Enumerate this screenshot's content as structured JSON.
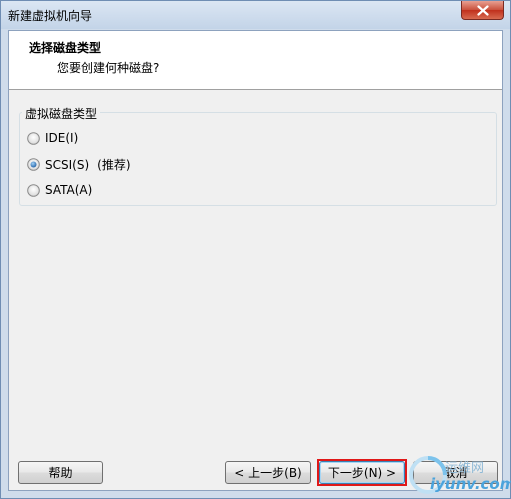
{
  "window": {
    "title": "新建虚拟机向导",
    "close_icon": "close-icon"
  },
  "header": {
    "title": "选择磁盘类型",
    "subtitle": "您要创建何种磁盘?"
  },
  "disk_type_group": {
    "label": "虚拟磁盘类型",
    "options": [
      {
        "label": "IDE(I)",
        "selected": false
      },
      {
        "label": "SCSI(S)",
        "selected": true,
        "note": "(推荐)"
      },
      {
        "label": "SATA(A)",
        "selected": false
      }
    ]
  },
  "buttons": {
    "help": "帮助",
    "prev": "< 上一步(B)",
    "next": "下一步(N) >",
    "cancel": "取消"
  },
  "watermark": {
    "top": "运维网",
    "bottom": "iyunv.com"
  },
  "colors": {
    "title_bar": "#c9d9ec",
    "highlight_box": "#e01818",
    "watermark": "#4aa3dc"
  }
}
